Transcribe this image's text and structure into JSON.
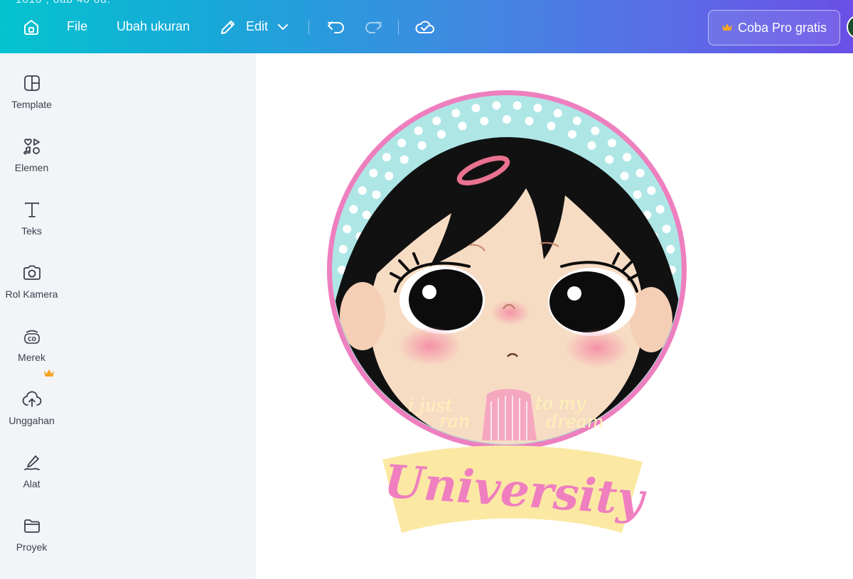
{
  "topbar": {
    "peek_text": "1o1o , oab 4o ou.",
    "file_label": "File",
    "resize_label": "Ubah ukuran",
    "edit_label": "Edit",
    "pro_label": "Coba Pro gratis"
  },
  "sidebar": {
    "items": [
      {
        "label": "Template",
        "icon": "template-icon"
      },
      {
        "label": "Elemen",
        "icon": "elements-icon"
      },
      {
        "label": "Teks",
        "icon": "text-icon"
      },
      {
        "label": "Rol Kamera",
        "icon": "camera-icon"
      },
      {
        "label": "Merek",
        "icon": "brand-icon"
      },
      {
        "label": "Unggahan",
        "icon": "upload-icon"
      },
      {
        "label": "Alat",
        "icon": "tools-icon"
      },
      {
        "label": "Proyek",
        "icon": "folder-icon"
      }
    ]
  },
  "sticker": {
    "line1a": "i just",
    "line1b": "ran",
    "line2a": "to my",
    "line2b": "dream",
    "banner": "University"
  },
  "colors": {
    "accent_crown": "#f5a623",
    "ring_pink": "#ee7fbf",
    "dot_band": "#aee6e6",
    "banner_yellow": "#fbe9a3",
    "banner_text": "#ef7fbf",
    "small_text": "#fff2b8"
  }
}
